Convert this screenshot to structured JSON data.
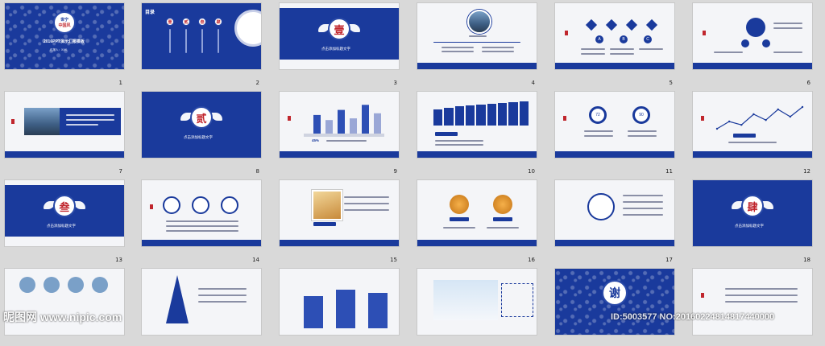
{
  "slide_numbers": [
    "1",
    "2",
    "3",
    "4",
    "5",
    "6",
    "7",
    "8",
    "9",
    "10",
    "11",
    "12",
    "13",
    "14",
    "15",
    "16",
    "17",
    "18"
  ],
  "slide1": {
    "badge_top": "世宁",
    "badge_mid": "中国风",
    "title": "2016PPT演示汇报模板",
    "subtitle": "汇报人：XXX"
  },
  "slide2": {
    "heading": "目录",
    "items": [
      "壹",
      "贰",
      "叁",
      "肆"
    ]
  },
  "section_chars": {
    "s3": "壹",
    "s8": "贰",
    "s13": "叁",
    "s18": "肆"
  },
  "section_caption": "点击添加标题文字",
  "slide5": {
    "labels": [
      "A",
      "B",
      "C"
    ]
  },
  "slide9": {
    "label": "45%"
  },
  "slide11": {
    "values": [
      "72",
      "90"
    ],
    "unit": "%"
  },
  "slide19": {
    "char": "谢"
  },
  "chart_data": [
    {
      "type": "bar",
      "slide": "9",
      "values": [
        55,
        40,
        70,
        45,
        85,
        60
      ],
      "label": "45%"
    },
    {
      "type": "line",
      "slide": "12",
      "values": [
        10,
        25,
        18,
        40,
        28,
        50,
        35,
        55
      ]
    }
  ],
  "watermark": {
    "left": "昵图网 www.nipic.com",
    "right": "ID:5003577 NO:20160224814817440000"
  },
  "colors": {
    "blue": "#1a3a9c",
    "red": "#c0262d",
    "bg": "#d9d9d9"
  }
}
